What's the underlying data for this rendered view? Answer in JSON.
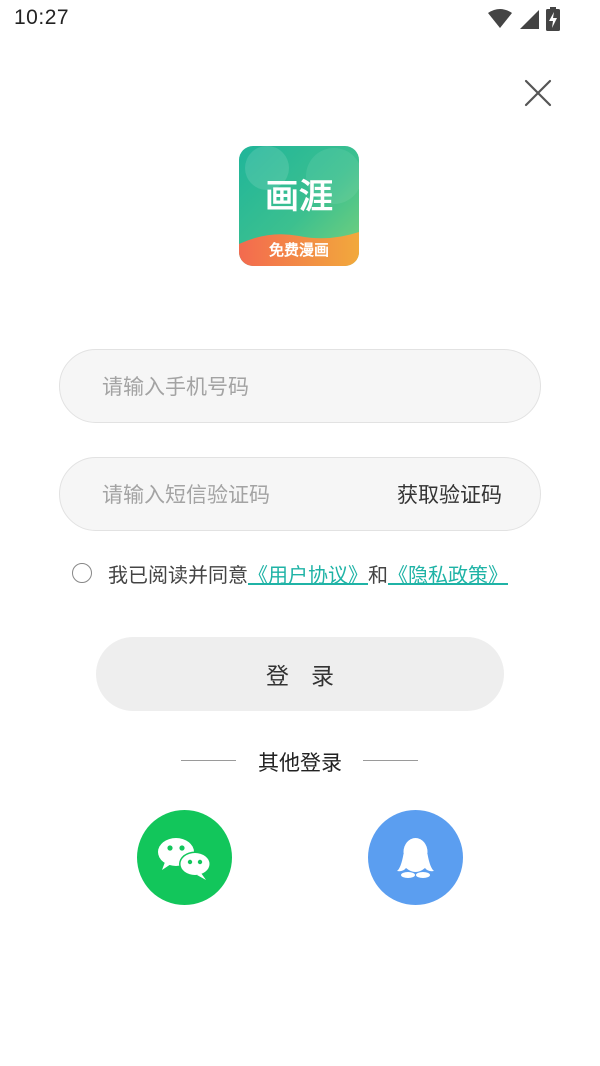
{
  "status_bar": {
    "time": "10:27",
    "icons": [
      "wifi-icon",
      "signal-icon",
      "battery-charging-icon"
    ]
  },
  "logo": {
    "title": "画涯",
    "subtitle": "免费漫画"
  },
  "phone_input": {
    "placeholder": "请输入手机号码",
    "value": ""
  },
  "sms_input": {
    "placeholder": "请输入短信验证码",
    "value": ""
  },
  "get_code_label": "获取验证码",
  "agreement": {
    "prefix": "我已阅读并同意",
    "user_agreement": "《用户协议》",
    "conjunction": "和",
    "privacy_policy": "《隐私政策》",
    "checked": false
  },
  "login_label": "登录",
  "other_login_label": "其他登录",
  "social": [
    {
      "name": "wechat",
      "icon": "wechat-icon",
      "color": "#12c65b"
    },
    {
      "name": "qq",
      "icon": "qq-icon",
      "color": "#5b9ef0"
    }
  ],
  "colors": {
    "link": "#1fb3a6",
    "input_bg": "#f6f6f6",
    "button_bg": "#eeeeee"
  }
}
